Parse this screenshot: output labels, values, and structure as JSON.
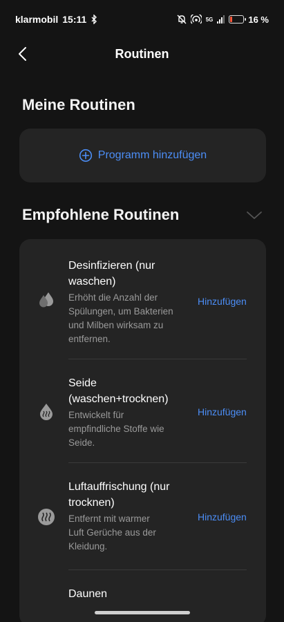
{
  "status": {
    "carrier": "klarmobil",
    "time": "15:11",
    "network": "5G",
    "battery": "16 %",
    "battery_level": 0.16
  },
  "header": {
    "title": "Routinen"
  },
  "my_routines": {
    "title": "Meine Routinen",
    "add_label": "Programm hinzufügen"
  },
  "recommended": {
    "title": "Empfohlene Routinen",
    "items": [
      {
        "name_l1": "Desinfizieren (nur",
        "name_l2": "waschen)",
        "desc_l1": "Erhöht die Anzahl der",
        "desc_l2": "Spülungen, um Bakterien",
        "desc_l3": "und Milben wirksam zu",
        "desc_l4": "entfernen.",
        "action": "Hinzufügen",
        "icon": "drops-icon"
      },
      {
        "name_l1": "Seide",
        "name_l2": "(waschen+trocknen)",
        "desc_l1": "Entwickelt für",
        "desc_l2": "empfindliche Stoffe wie",
        "desc_l3": "Seide.",
        "action": "Hinzufügen",
        "icon": "drop-steam-icon"
      },
      {
        "name_l1": "Luftauffrischung (nur",
        "name_l2": "trocknen)",
        "desc_l1": "Entfernt mit warmer",
        "desc_l2": "Luft Gerüche aus der",
        "desc_l3": "Kleidung.",
        "action": "Hinzufügen",
        "icon": "steam-icon"
      },
      {
        "name_l1": "Daunen"
      }
    ]
  },
  "colors": {
    "accent": "#4c8ef7",
    "background": "#141414",
    "card": "#242424",
    "secondary_text": "#9a9a9a"
  }
}
